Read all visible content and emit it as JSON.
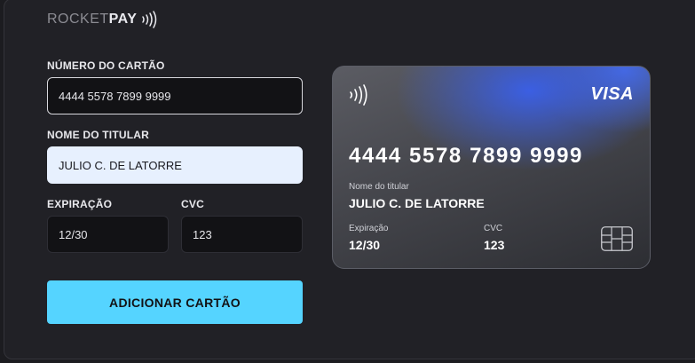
{
  "brand": {
    "logo_light": "ROCKET",
    "logo_bold": "PAY"
  },
  "form": {
    "number_label": "NÚMERO DO CARTÃO",
    "number_value": "4444 5578 7899 9999",
    "holder_label": "NOME DO TITULAR",
    "holder_value": "JULIO C. DE LATORRE",
    "expiry_label": "EXPIRAÇÃO",
    "expiry_value": "12/30",
    "cvc_label": "CVC",
    "cvc_value": "123",
    "submit_label": "ADICIONAR CARTÃO"
  },
  "card": {
    "brand": "VISA",
    "number": "4444 5578 7899 9999",
    "holder_caption": "Nome do titular",
    "holder": "JULIO C. DE LATORRE",
    "expiry_caption": "Expiração",
    "expiry": "12/30",
    "cvc_caption": "CVC",
    "cvc": "123"
  },
  "icons": {
    "logo_icon": "contactless-icon",
    "card_icon": "contactless-icon",
    "chip": "card-chip-icon"
  },
  "colors": {
    "accent": "#55d4ff",
    "background": "#212126",
    "card_glow": "#3a60eb"
  }
}
